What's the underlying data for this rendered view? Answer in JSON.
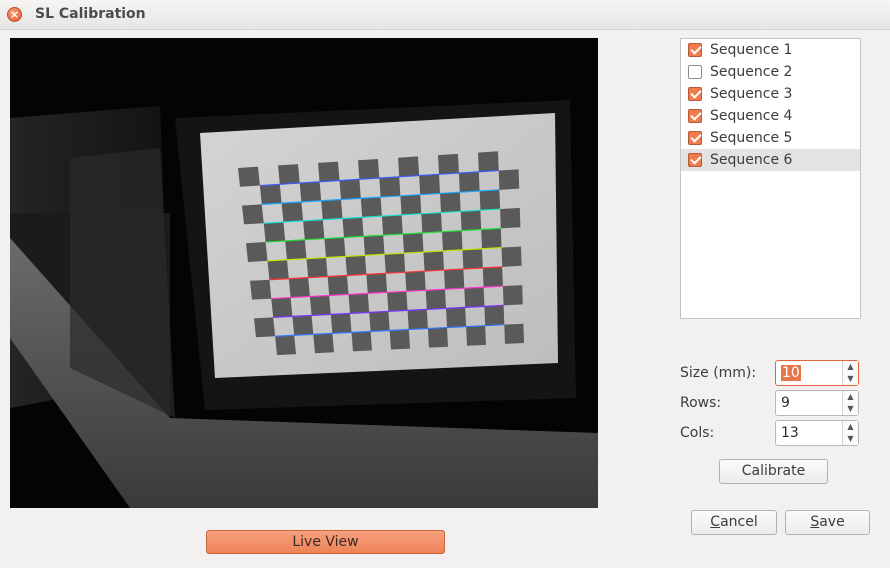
{
  "window": {
    "title": "SL Calibration"
  },
  "icons": {
    "close": "close-icon"
  },
  "live_view_label": "Live View",
  "sequences": [
    {
      "label": "Sequence 1",
      "checked": true,
      "selected": false
    },
    {
      "label": "Sequence 2",
      "checked": false,
      "selected": false
    },
    {
      "label": "Sequence 3",
      "checked": true,
      "selected": false
    },
    {
      "label": "Sequence 4",
      "checked": true,
      "selected": false
    },
    {
      "label": "Sequence 5",
      "checked": true,
      "selected": false
    },
    {
      "label": "Sequence 6",
      "checked": true,
      "selected": true
    }
  ],
  "params": {
    "size_label": "Size (mm):",
    "size_value": "10",
    "rows_label": "Rows:",
    "rows_value": "9",
    "cols_label": "Cols:",
    "cols_value": "13"
  },
  "buttons": {
    "calibrate": "Calibrate",
    "cancel_mnemonic": "C",
    "cancel_rest": "ancel",
    "save_mnemonic": "S",
    "save_rest": "ave"
  },
  "colors": {
    "accent": "#ee7c4e",
    "window_bg": "#f2f1f0"
  }
}
